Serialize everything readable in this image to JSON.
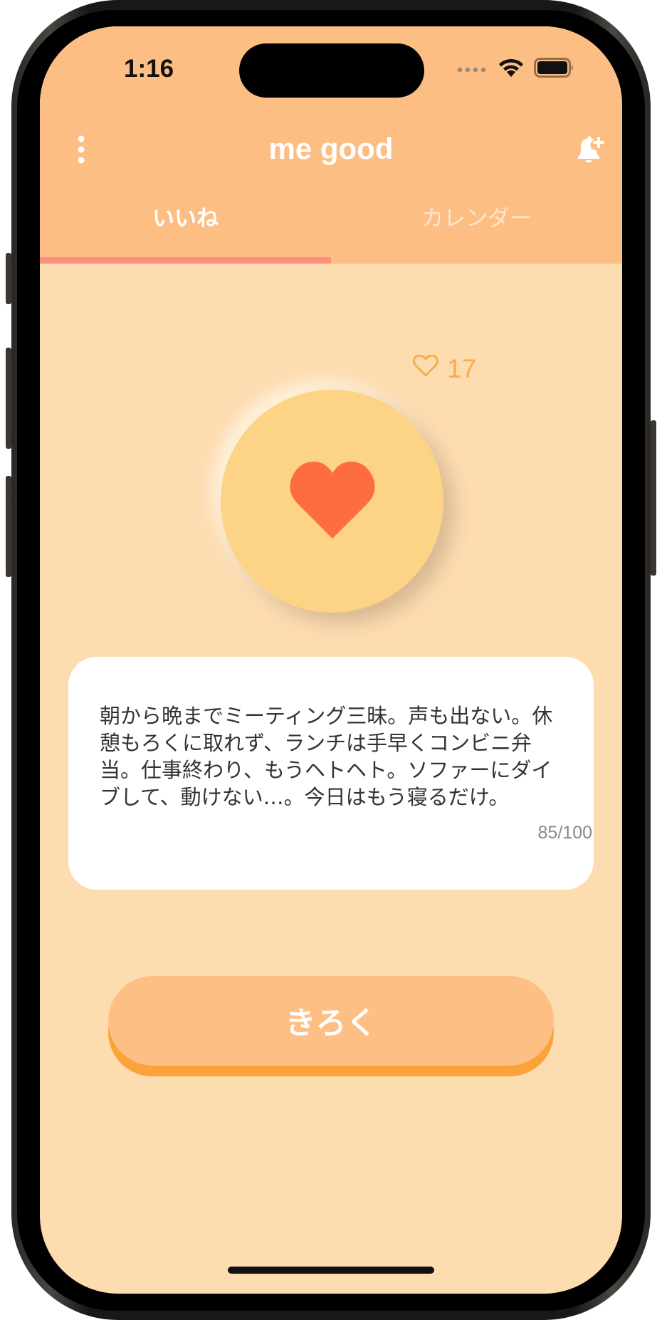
{
  "status_bar": {
    "time": "1:16",
    "signal_icon": "cellular-dots-icon",
    "wifi_icon": "wifi-icon",
    "battery_icon": "battery-icon"
  },
  "header": {
    "title": "me good",
    "menu_icon": "vertical-dots-icon",
    "bell_icon": "bell-plus-icon"
  },
  "tabs": [
    {
      "label": "いいね",
      "active": true
    },
    {
      "label": "カレンダー",
      "active": false
    }
  ],
  "like": {
    "icon": "heart-outline-icon",
    "count": "17",
    "button_icon": "heart-icon"
  },
  "note": {
    "text": "朝から晩までミーティング三昧。声も出ない。休\n憩もろくに取れず、ランチは手早くコンビニ弁\n当。仕事終わり、もうヘトヘト。ソファーにダイ\nブして、動けない…。今日はもう寝るだけ。",
    "counter": "85/100"
  },
  "record_button": {
    "label": "きろく"
  },
  "colors": {
    "header_bg": "#fdbe83",
    "body_bg": "#fddcb0",
    "tab_indicator": "#fd8f7d",
    "accent_orange": "#fbab47",
    "heart": "#fe6d40",
    "like_circle": "#fdd385",
    "button_shadow": "#fba23a"
  }
}
